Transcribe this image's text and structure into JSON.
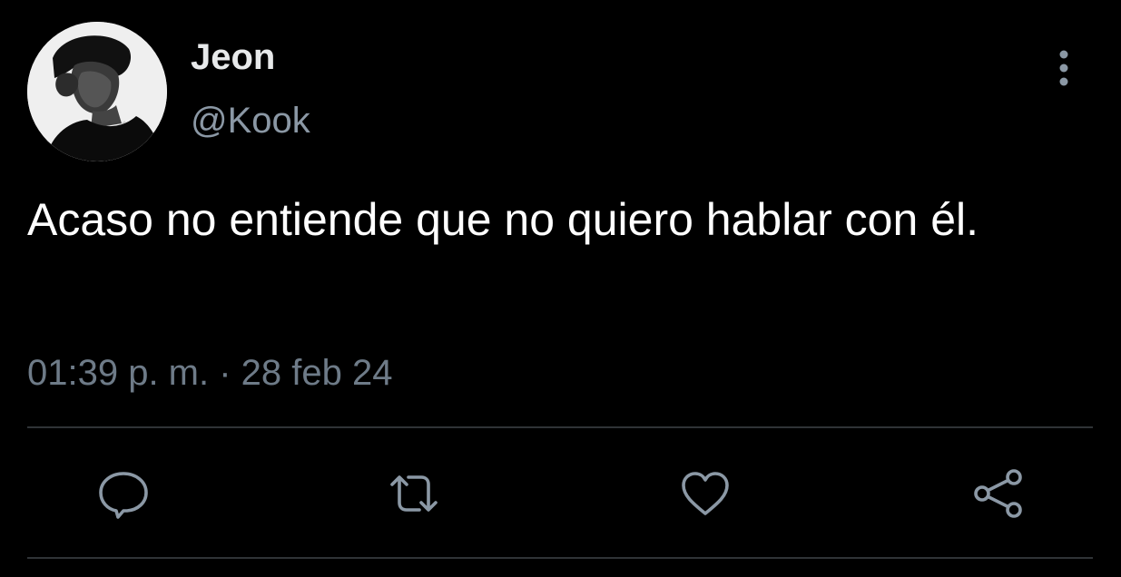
{
  "tweet": {
    "display_name": "Jeon",
    "handle": "@Kook",
    "text": "Acaso no entiende que no quiero hablar con él.",
    "timestamp": "01:39 p. m. · 28 feb 24"
  },
  "icons": {
    "avatar": "avatar",
    "more": "more-vertical-icon",
    "reply": "reply-icon",
    "retweet": "retweet-icon",
    "like": "heart-icon",
    "share": "share-icon"
  },
  "colors": {
    "background": "#000000",
    "primary_text": "#ffffff",
    "secondary_text": "#8b98a5",
    "icon": "#8b98a5",
    "divider": "#2f3336"
  }
}
